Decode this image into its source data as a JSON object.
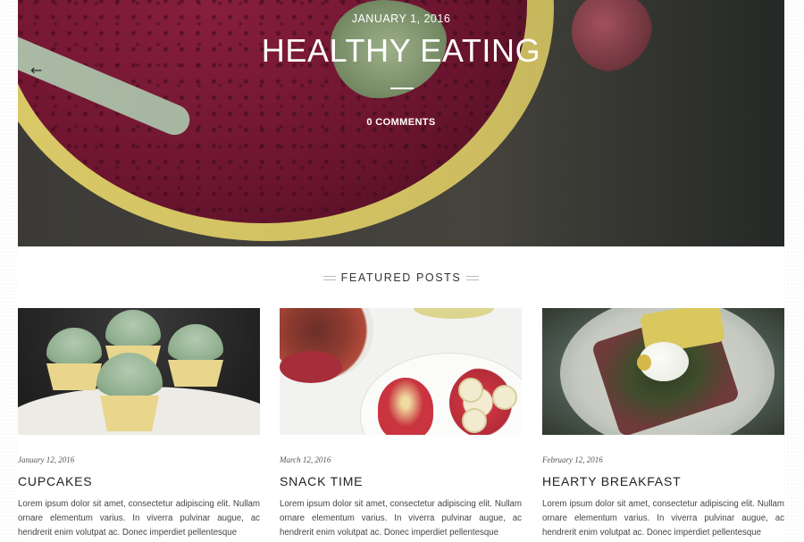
{
  "hero": {
    "date": "JANUARY 1, 2016",
    "title": "HEALTHY EATING",
    "comments": "0 COMMENTS",
    "prev_arrow": "←"
  },
  "featured": {
    "heading": "FEATURED POSTS"
  },
  "posts": [
    {
      "date": "January 12, 2016",
      "title": "CUPCAKES",
      "excerpt": "Lorem ipsum dolor sit amet, consectetur adipiscing elit. Nullam ornare elementum varius. In viverra pulvinar augue, ac hendrerit enim volutpat ac. Donec imperdiet pellentesque"
    },
    {
      "date": "March 12, 2016",
      "title": "SNACK TIME",
      "excerpt": "Lorem ipsum dolor sit amet, consectetur adipiscing elit. Nullam ornare elementum varius. In viverra pulvinar augue, ac hendrerit enim volutpat ac. Donec imperdiet pellentesque"
    },
    {
      "date": "February 12, 2016",
      "title": "HEARTY BREAKFAST",
      "excerpt": "Lorem ipsum dolor sit amet, consectetur adipiscing elit. Nullam ornare elementum varius. In viverra pulvinar augue, ac hendrerit enim volutpat ac. Donec imperdiet pellentesque"
    }
  ],
  "colors": {
    "hero_overlay_text": "#ffffff",
    "heading_text": "#333333",
    "body_text": "#444444"
  }
}
